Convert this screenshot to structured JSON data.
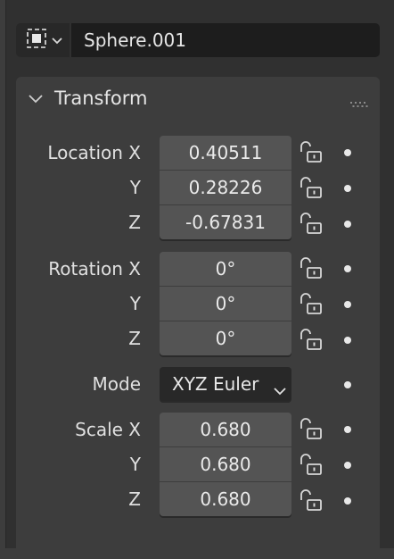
{
  "object": {
    "type_icon": "mesh-object-icon",
    "name": "Sphere.001"
  },
  "transform": {
    "title": "Transform",
    "location": {
      "label_x": "Location X",
      "label_y": "Y",
      "label_z": "Z",
      "x": "0.40511",
      "y": "0.28226",
      "z": "-0.67831"
    },
    "rotation": {
      "label_x": "Rotation X",
      "label_y": "Y",
      "label_z": "Z",
      "x": "0°",
      "y": "0°",
      "z": "0°"
    },
    "mode": {
      "label": "Mode",
      "value": "XYZ Euler"
    },
    "scale": {
      "label_x": "Scale X",
      "label_y": "Y",
      "label_z": "Z",
      "x": "0.680",
      "y": "0.680",
      "z": "0.680"
    }
  },
  "colors": {
    "panel_bg": "#3d3d3d",
    "field_bg": "#545454",
    "name_field_bg": "#1d1d1d",
    "select_bg": "#282828"
  }
}
